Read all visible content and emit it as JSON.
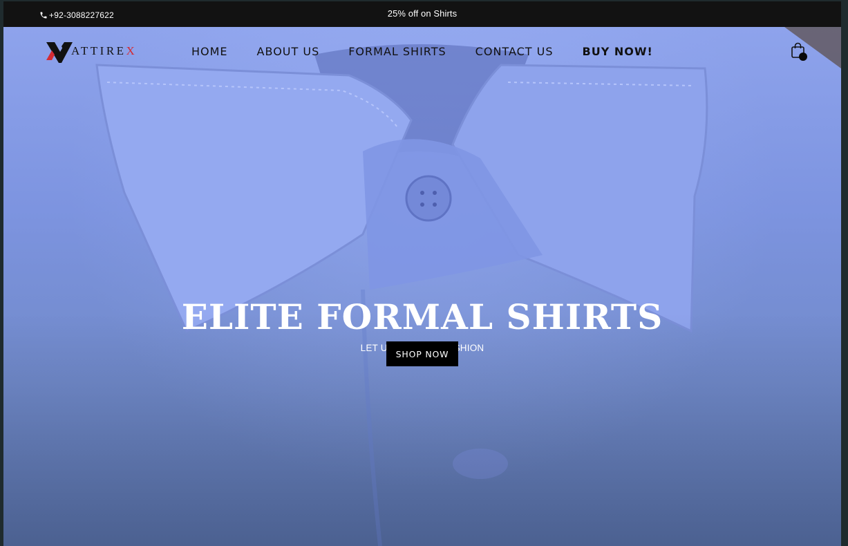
{
  "topbar": {
    "phone": "+92-3088227622",
    "promo": "25% off on Shirts"
  },
  "brand": {
    "name_main": "ATTIRE",
    "name_accent": "X",
    "accent_color": "#d32b35"
  },
  "nav": {
    "items": [
      {
        "label": "HOME"
      },
      {
        "label": "ABOUT US"
      },
      {
        "label": "FORMAL SHIRTS"
      },
      {
        "label": "CONTACT US"
      },
      {
        "label": "BUY NOW!"
      }
    ],
    "cart_icon": "shopping-bag-icon"
  },
  "hero": {
    "title": "ELITE FORMAL SHIRTS",
    "subtitle": "LET US BE YOUR FASHION",
    "cta": "SHOP NOW"
  }
}
